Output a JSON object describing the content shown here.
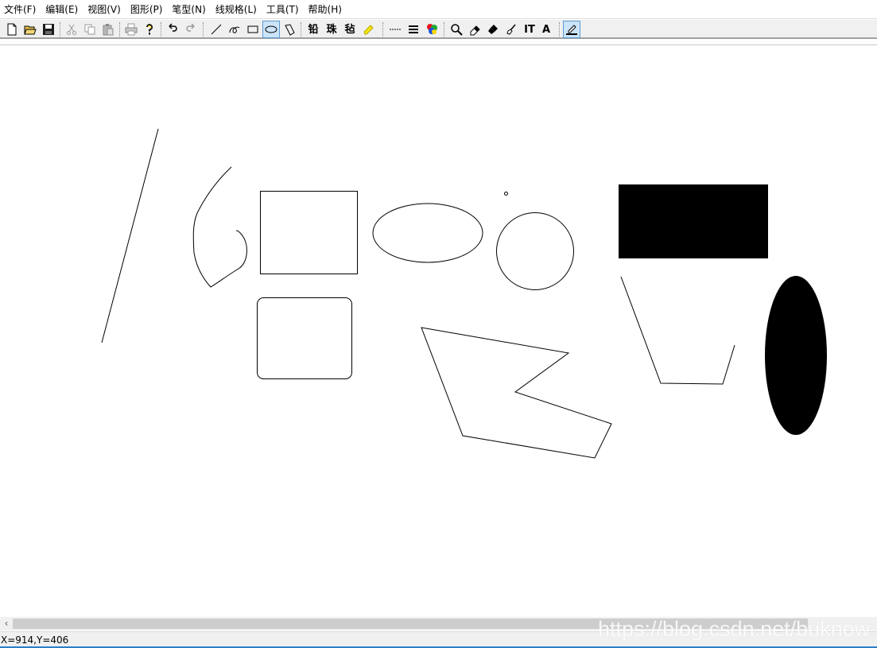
{
  "menu": [
    {
      "label": "文件(F)"
    },
    {
      "label": "编辑(E)"
    },
    {
      "label": "视图(V)"
    },
    {
      "label": "图形(P)"
    },
    {
      "label": "笔型(N)"
    },
    {
      "label": "线规格(L)"
    },
    {
      "label": "工具(T)"
    },
    {
      "label": "帮助(H)"
    }
  ],
  "toolbar": {
    "pen_label_1": "铅",
    "pen_label_2": "珠",
    "pen_label_3": "毡",
    "text_tool_label": "IT",
    "font_label": "A",
    "active_tool": "ellipse",
    "highlighter_color": "#f5e70a"
  },
  "status": {
    "coords": "X=914,Y=406"
  },
  "watermark": "https://blog.csdn.net/buknow",
  "colors": {
    "pressed_bg": "#cce4f7",
    "pressed_border": "#5a9bd5",
    "stroke": "#000000",
    "fill": "#000000"
  }
}
